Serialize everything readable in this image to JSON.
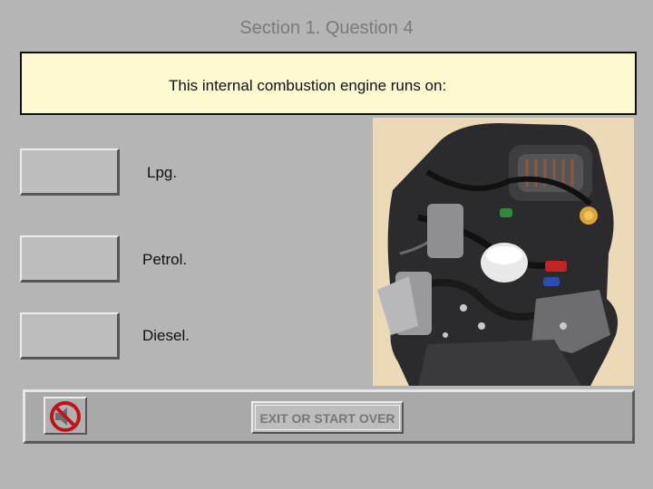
{
  "header": {
    "title": "Section 1. Question 4"
  },
  "question": {
    "text": "This internal combustion engine runs on:"
  },
  "answers": [
    {
      "label": "Lpg."
    },
    {
      "label": "Petrol."
    },
    {
      "label": "Diesel."
    }
  ],
  "footer": {
    "exit_label": "EXIT OR START OVER"
  },
  "icons": {
    "sound": "sound-off-icon"
  },
  "colors": {
    "background": "#b5b5b5",
    "question_bg": "#fcf8d2",
    "mute_red": "#c0141a"
  }
}
